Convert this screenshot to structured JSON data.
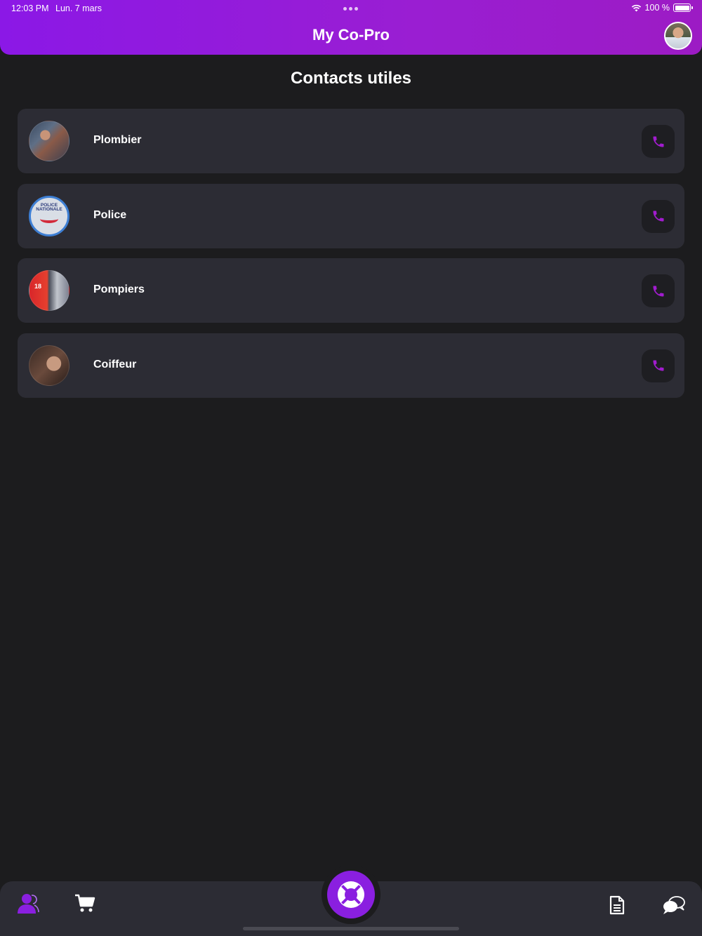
{
  "status_bar": {
    "time": "12:03 PM",
    "date": "Lun. 7 mars",
    "battery": "100 %",
    "icons": [
      "multitask-dots-icon",
      "wifi-icon",
      "battery-icon"
    ]
  },
  "header": {
    "title": "My Co-Pro",
    "avatar_icon": "profile-avatar",
    "colors": {
      "gradient_start": "#8b18e6",
      "gradient_end": "#9c1bc4"
    }
  },
  "page": {
    "title": "Contacts utiles"
  },
  "contacts": [
    {
      "name": "Plombier",
      "avatar_icon": "plumber-photo",
      "action_icon": "phone-icon"
    },
    {
      "name": "Police",
      "avatar_icon": "police-nationale-logo",
      "logo_text": "POLICE NATIONALE",
      "action_icon": "phone-icon"
    },
    {
      "name": "Pompiers",
      "avatar_icon": "firefighter-photo",
      "badge_text": "18",
      "action_icon": "phone-icon"
    },
    {
      "name": "Coiffeur",
      "avatar_icon": "barber-photo",
      "action_icon": "phone-icon"
    }
  ],
  "tabbar": {
    "items": [
      "contacts-icon",
      "cart-icon",
      "help-lifebuoy-icon",
      "document-icon",
      "chat-icon"
    ],
    "active": "contacts-icon"
  },
  "colors": {
    "background": "#1c1c1e",
    "card": "#2c2c34",
    "accent": "#8a1fe0",
    "phone_icon": "#a21ccf"
  }
}
